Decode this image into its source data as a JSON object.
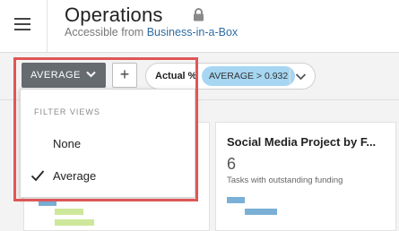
{
  "header": {
    "title": "Operations",
    "subtitle_prefix": "Accessible from",
    "subtitle_link": "Business-in-a-Box",
    "menu_icon": "hamburger-menu-icon",
    "lock_icon": "lock-icon"
  },
  "toolbar": {
    "view_select_label": "AVERAGE",
    "add_label": "+",
    "filter_label": "Actual %",
    "filter_chip": "AVERAGE > 0.932"
  },
  "dropdown": {
    "header": "FILTER VIEWS",
    "items": [
      {
        "label": "None",
        "selected": false
      },
      {
        "label": "Average",
        "selected": true
      }
    ]
  },
  "cards": [
    {
      "title": "Social Media Project by F...",
      "value": "6",
      "caption": "Tasks with outstanding funding"
    }
  ],
  "colors": {
    "highlight": "#e05656",
    "view_select_bg": "#666b70",
    "chip_bg": "#a6d6f2",
    "link": "#2e6da4",
    "bar_blue": "#7ab0d6",
    "bar_green": "#cde89a"
  }
}
